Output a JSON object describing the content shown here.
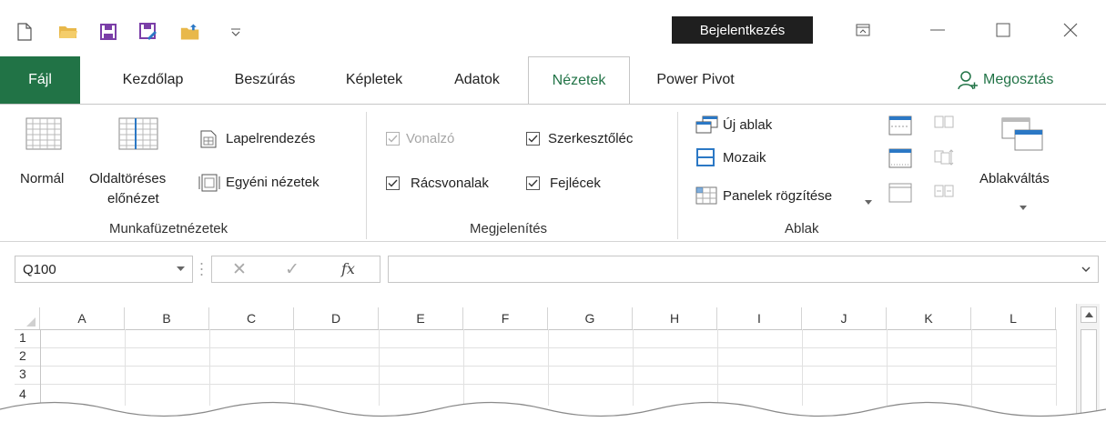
{
  "title_bar": {
    "qat_icons": [
      "new-document-icon",
      "open-folder-icon",
      "save-icon",
      "save-as-icon",
      "folder-up-icon",
      "qat-customize-icon"
    ],
    "login_label": "Bejelentkezés"
  },
  "tabs": [
    {
      "label": "Fájl"
    },
    {
      "label": "Kezdőlap"
    },
    {
      "label": "Beszúrás"
    },
    {
      "label": "Képletek"
    },
    {
      "label": "Adatok"
    },
    {
      "label": "Nézetek"
    },
    {
      "label": "Power Pivot"
    }
  ],
  "share_label": "Megosztás",
  "ribbon": {
    "workbook_views": {
      "normal": "Normál",
      "page_break_line1": "Oldaltöréses",
      "page_break_line2": "előnézet",
      "page_layout": "Lapelrendezés",
      "custom_views": "Egyéni nézetek",
      "group_label": "Munkafüzetnézetek"
    },
    "show": {
      "ruler": "Vonalzó",
      "ruler_checked": true,
      "ruler_disabled": true,
      "formula_bar": "Szerkesztőléc",
      "formula_bar_checked": true,
      "gridlines": "Rácsvonalak",
      "gridlines_checked": true,
      "headings": "Fejlécek",
      "headings_checked": true,
      "group_label": "Megjelenítés"
    },
    "window": {
      "new_window": "Új ablak",
      "arrange": "Mozaik",
      "freeze_panes": "Panelek rögzítése",
      "switch_windows": "Ablakváltás",
      "group_label": "Ablak"
    }
  },
  "formula_bar": {
    "name_box": "Q100",
    "cancel_symbol": "✕",
    "enter_symbol": "✓",
    "fx_symbol": "fx",
    "formula_value": ""
  },
  "grid": {
    "columns": [
      "A",
      "B",
      "C",
      "D",
      "E",
      "F",
      "G",
      "H",
      "I",
      "J",
      "K",
      "L"
    ],
    "rows": [
      "1",
      "2",
      "3",
      "4"
    ]
  },
  "colors": {
    "accent": "#217346",
    "login_bg": "#1f1f1f",
    "border": "#c6c6c6"
  }
}
